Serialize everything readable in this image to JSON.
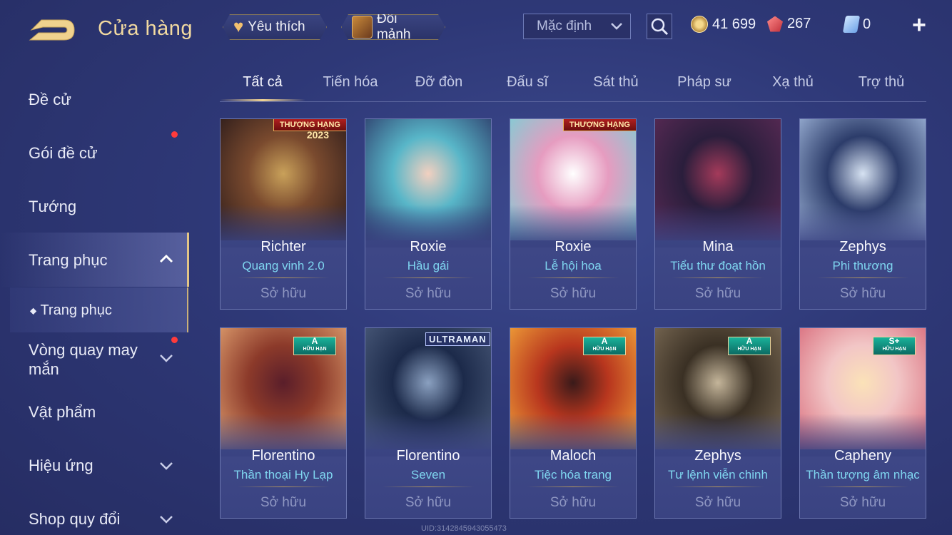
{
  "header": {
    "title": "Cửa hàng",
    "favorite_label": "Yêu thích",
    "shard_label": "Đổi mảnh",
    "sort": {
      "selected": "Mặc định"
    },
    "currencies": {
      "coins": "41 699",
      "gems": "267",
      "tickets": "0"
    }
  },
  "sidebar": {
    "items": [
      {
        "label": "Đề cử"
      },
      {
        "label": "Gói đề cử"
      },
      {
        "label": "Tướng"
      },
      {
        "label": "Trang phục"
      },
      {
        "label": "Trang phục"
      },
      {
        "label": "Vòng quay may mắn"
      },
      {
        "label": "Vật phẩm"
      },
      {
        "label": "Hiệu ứng"
      },
      {
        "label": "Shop quy đổi"
      }
    ]
  },
  "tabs": [
    {
      "label": "Tất cả"
    },
    {
      "label": "Tiến hóa"
    },
    {
      "label": "Đỡ đòn"
    },
    {
      "label": "Đấu sĩ"
    },
    {
      "label": "Sát thủ"
    },
    {
      "label": "Pháp sư"
    },
    {
      "label": "Xạ thủ"
    },
    {
      "label": "Trợ thủ"
    }
  ],
  "cards": [
    {
      "hero": "Richter",
      "skin": "Quang vinh 2.0",
      "status": "Sở hữu",
      "badge": "THƯỢNG HẠNG",
      "badge_year": "2023"
    },
    {
      "hero": "Roxie",
      "skin": "Hầu gái",
      "status": "Sở hữu"
    },
    {
      "hero": "Roxie",
      "skin": "Lễ hội hoa",
      "status": "Sở hữu",
      "badge": "THƯỢNG HẠNG"
    },
    {
      "hero": "Mina",
      "skin": "Tiểu thư đoạt hồn",
      "status": "Sở hữu"
    },
    {
      "hero": "Zephys",
      "skin": "Phi thương",
      "status": "Sở hữu"
    },
    {
      "hero": "Florentino",
      "skin": "Thần thoại Hy Lạp",
      "status": "Sở hữu",
      "rank": "A",
      "rank_sub": "HỮU HẠN"
    },
    {
      "hero": "Florentino",
      "skin": "Seven",
      "status": "Sở hữu",
      "brand": "ULTRAMAN"
    },
    {
      "hero": "Maloch",
      "skin": "Tiệc hóa trang",
      "status": "Sở hữu",
      "rank": "A",
      "rank_sub": "HỮU HẠN"
    },
    {
      "hero": "Zephys",
      "skin": "Tư lệnh viễn chinh",
      "status": "Sở hữu",
      "rank": "A",
      "rank_sub": "HỮU HẠN"
    },
    {
      "hero": "Capheny",
      "skin": "Thần tượng âm nhạc",
      "status": "Sở hữu",
      "rank": "S+",
      "rank_sub": "HỮU HẠN"
    }
  ],
  "watermark": "UID:3142845943055473",
  "colors": {
    "accent_gold": "#e2c586",
    "skin_text": "#7fd6f0",
    "notification": "#ff3b3b"
  }
}
